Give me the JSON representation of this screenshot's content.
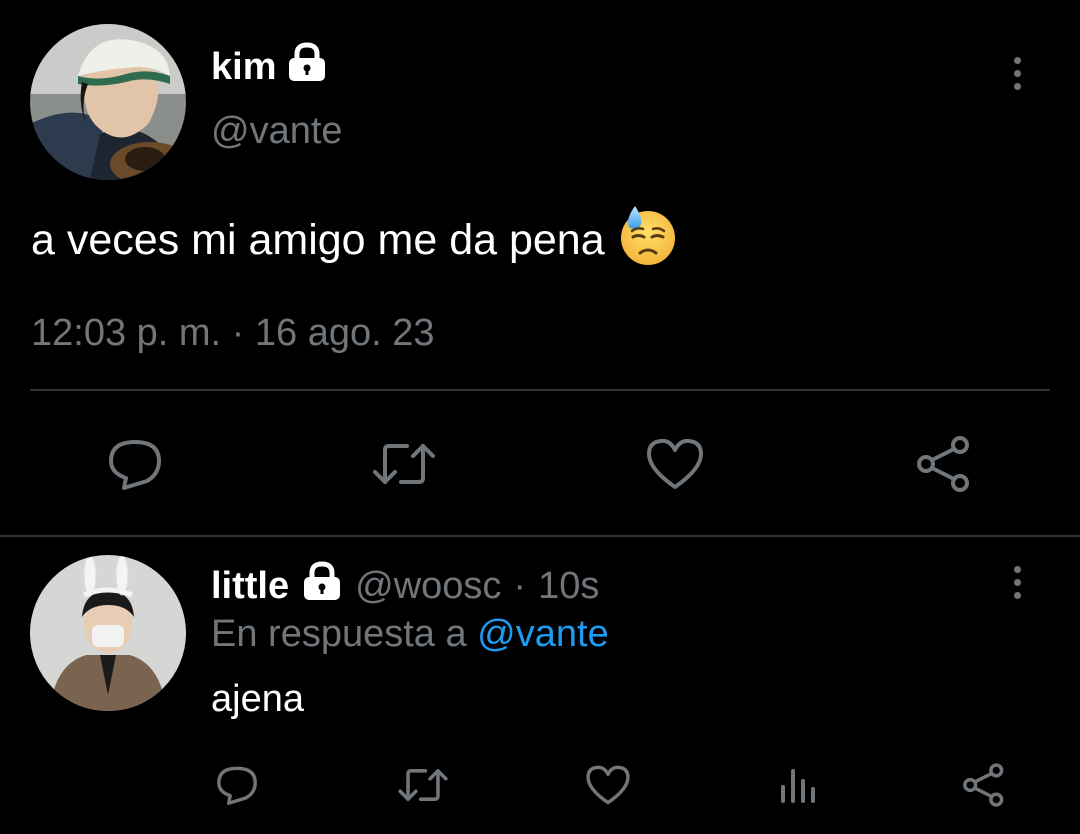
{
  "main_tweet": {
    "author_name": "kim",
    "author_handle": "@vante",
    "text": "a veces mi amigo me da pena",
    "emoji": "😓",
    "timestamp": "12:03 p. m. · 16 ago. 23",
    "protected_icon": "lock-icon",
    "actions": [
      {
        "name": "reply",
        "icon": "reply-icon"
      },
      {
        "name": "retweet",
        "icon": "retweet-icon"
      },
      {
        "name": "like",
        "icon": "like-icon"
      },
      {
        "name": "share",
        "icon": "share-icon"
      }
    ]
  },
  "reply_tweet": {
    "author_name": "little",
    "author_handle": "@woosc",
    "separator": "·",
    "time": "10s",
    "replying_prefix": "En respuesta a",
    "replying_to": "@vante",
    "text": "ajena",
    "protected_icon": "lock-icon",
    "actions": [
      {
        "name": "reply",
        "icon": "reply-icon"
      },
      {
        "name": "retweet",
        "icon": "retweet-icon"
      },
      {
        "name": "like",
        "icon": "like-icon"
      },
      {
        "name": "analytics",
        "icon": "analytics-icon"
      },
      {
        "name": "share",
        "icon": "share-icon"
      }
    ]
  },
  "colors": {
    "background": "#000000",
    "primary_text": "#ffffff",
    "secondary_text": "#71767b",
    "link": "#1d9bf0",
    "divider": "#2f3336"
  }
}
